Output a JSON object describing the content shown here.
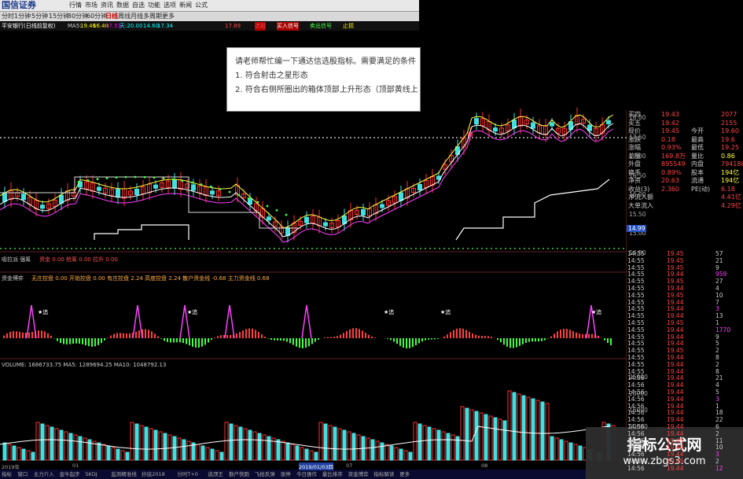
{
  "app": {
    "logo": "国信证券"
  },
  "menu": [
    "行情",
    "市场",
    "资讯",
    "数据",
    "自选",
    "功能",
    "选项",
    "新闻",
    "公式"
  ],
  "periods": [
    "分时",
    "1分钟",
    "5分钟",
    "15分钟",
    "30分钟",
    "60分钟",
    "日线",
    "周线",
    "月线",
    "多周期",
    "更多"
  ],
  "infoline": [
    "平安银行(日线前复权)",
    "MA5:",
    "19.46",
    "16.40",
    "17.53",
    "天:20.00",
    "14.60",
    "17.34",
    "17.89",
    "选股",
    "买入信号",
    "卖出信号",
    "止损"
  ],
  "dialog": {
    "line1": "请老师帮忙编一下通达信选股指标。需要满足的条件",
    "line2": "1. 符合射击之星形态",
    "line3": "2. 符合右侧所圈出的箱体顶部上升形态（顶部黄线上"
  },
  "main_axis": [
    "18.00",
    "17.50",
    "17.00",
    "16.50",
    "16.00",
    "15.50",
    "15.00",
    "14.50"
  ],
  "current_price_tag": "14.99",
  "quotes": [
    {
      "l": "买四",
      "v": "19.43",
      "l2": "",
      "v2": "2077"
    },
    {
      "l": "买五",
      "v": "19.42",
      "l2": "",
      "v2": "2155"
    },
    {
      "l": "现价",
      "v": "19.45",
      "l2": "今开",
      "v2": "19.60"
    },
    {
      "l": "涨跌",
      "v": "0.18",
      "l2": "最高",
      "v2": "19.6"
    },
    {
      "l": "涨幅",
      "v": "0.93%",
      "l2": "最低",
      "v2": "19.25"
    },
    {
      "l": "总量",
      "v": "169.8万",
      "l2": "量比",
      "v2": "0.86"
    },
    {
      "l": "外盘",
      "v": "895549",
      "l2": "内盘",
      "v2": "794188"
    },
    {
      "l": "换手",
      "v": "0.89%",
      "l2": "股本",
      "v2": "194亿"
    },
    {
      "l": "净资",
      "v": "20.63",
      "l2": "流通",
      "v2": "194亿"
    },
    {
      "l": "收益(3)",
      "v": "2.360",
      "l2": "PE(动)",
      "v2": "6.18"
    },
    {
      "l": "净流入额",
      "v": "",
      "l2": "",
      "v2": "4.41亿"
    },
    {
      "l": "大单流入",
      "v": "",
      "l2": "",
      "v2": "4.29亿"
    }
  ],
  "ticks": [
    [
      "14:55",
      "19.45",
      "57"
    ],
    [
      "14:55",
      "19.45",
      "21"
    ],
    [
      "14:55",
      "19.45",
      "9"
    ],
    [
      "14:55",
      "19.44",
      "959"
    ],
    [
      "14:55",
      "19.45",
      "27"
    ],
    [
      "14:55",
      "19.44",
      "4"
    ],
    [
      "14:55",
      "19.45",
      "10"
    ],
    [
      "14:55",
      "19.44",
      "7"
    ],
    [
      "14:55",
      "19.44",
      "3"
    ],
    [
      "14:55",
      "19.44",
      "13"
    ],
    [
      "14:55",
      "19.45",
      "1"
    ],
    [
      "14:55",
      "19.44",
      "1770"
    ],
    [
      "14:55",
      "19.44",
      "9"
    ],
    [
      "14:55",
      "19.44",
      "5"
    ],
    [
      "14:55",
      "19.45",
      "2"
    ],
    [
      "14:55",
      "19.44",
      "8"
    ],
    [
      "14:55",
      "19.44",
      "2"
    ],
    [
      "14:55",
      "19.44",
      "8"
    ],
    [
      "14:56",
      "19.44",
      "21"
    ],
    [
      "14:56",
      "19.44",
      "4"
    ],
    [
      "14:56",
      "19.44",
      "5"
    ],
    [
      "14:56",
      "19.44",
      "3"
    ],
    [
      "14:56",
      "19.44",
      "1"
    ],
    [
      "14:56",
      "19.44",
      "18"
    ],
    [
      "14:56",
      "19.44",
      "22"
    ],
    [
      "14:56",
      "19.44",
      "6"
    ],
    [
      "14:56",
      "19.44",
      "2"
    ],
    [
      "14:56",
      "19.45",
      "11"
    ],
    [
      "14:56",
      "19.44",
      "10"
    ],
    [
      "14:56",
      "19.44",
      "3"
    ],
    [
      "14:56",
      "19.45",
      "2"
    ],
    [
      "14:56",
      "19.44",
      "12"
    ]
  ],
  "sub1": {
    "label": "吸拉派 强筹",
    "values": "资金 0.00 抢筹 0.00 拉升 0.00"
  },
  "sub2": {
    "label": "资金博弈",
    "values": "无庄控盘 0.00 开始控盘 0.00 有庄控盘 2.24 高度控盘 2.24 散户资金线 -0.68 主力资金线 0.68"
  },
  "sub2_tags": [
    "★追",
    "★追",
    "★追",
    "★追",
    "★追"
  ],
  "volume": {
    "label": "VOLUME: 1686733.75 MA5: 1289694.25 MA10: 1048792.13"
  },
  "vol_axis": [
    "25000",
    "20000",
    "15000",
    "10000",
    "5000"
  ],
  "date_labels": [
    "2019年",
    "01",
    "2019/01/03四",
    "07",
    "08"
  ],
  "bottom_tabs": [
    "指标",
    "窗口",
    "主力介入",
    "金牛起步",
    "SKDJ",
    "监测精准线",
    "抄底2018",
    "分时T+0",
    "选顶王",
    "散户快跑",
    "飞抢反弹",
    "涨停",
    "今日操作",
    "量比排序",
    "资金博弈",
    "指标解读",
    "更多"
  ],
  "watermark": {
    "title": "指标公式网",
    "url": "www.zbgs3.com"
  },
  "colors": {
    "bull": "#ff3030",
    "bear": "#40e0e0",
    "ma_white": "#ffffff",
    "ma_yellow": "#ffff40",
    "ma_magenta": "#ff40ff",
    "green_dot": "#40ff40"
  }
}
